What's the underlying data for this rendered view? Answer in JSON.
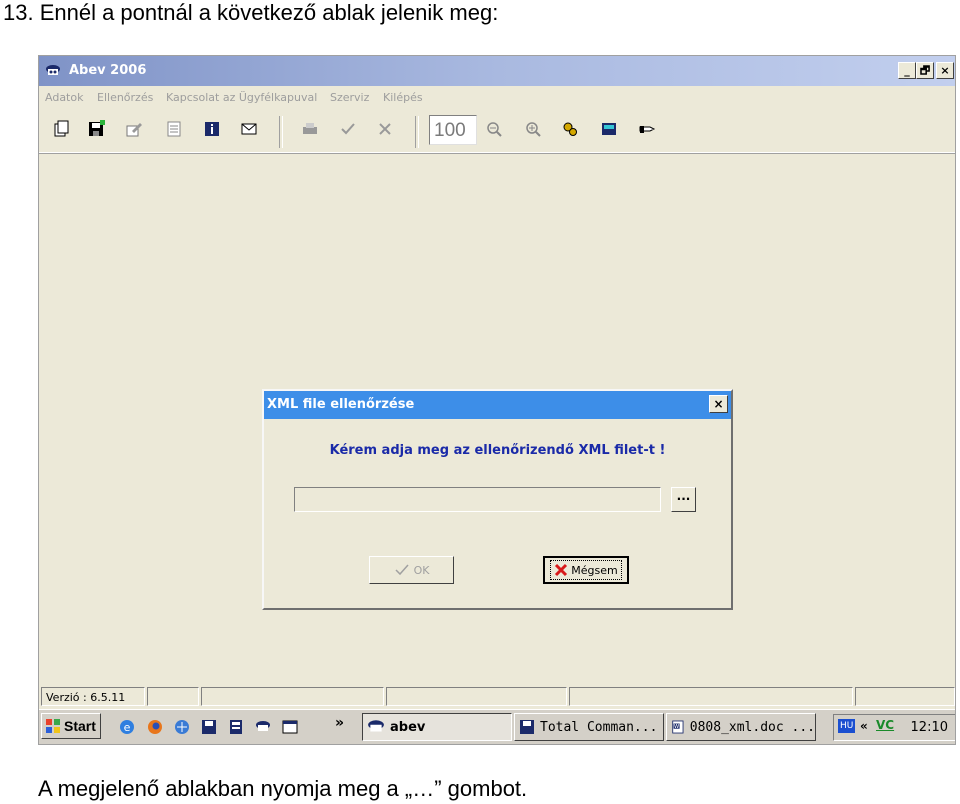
{
  "document": {
    "heading": "13. Ennél a pontnál a következő ablak jelenik meg:",
    "caption": "A megjelenő ablakban nyomja meg a „…” gombot."
  },
  "window": {
    "title": "Abev 2006",
    "app_icon": "abev-app-icon",
    "controls": {
      "minimize": "_",
      "restore": "🗗",
      "close": "×"
    }
  },
  "menu": {
    "items": [
      "Adatok",
      "Ellenőrzés",
      "Kapcsolat az Ügyfélkapuval",
      "Szerviz",
      "Kilépés"
    ]
  },
  "toolbar": {
    "icons": [
      "open-forms-icon",
      "save-icon",
      "edit-icon",
      "print-preview-icon",
      "info-icon",
      "mail-icon",
      "print-icon",
      "check-icon",
      "cancel-icon",
      "zoom-out-icon",
      "zoom-in-icon",
      "settings-icon",
      "calculator-icon",
      "pointer-hand-icon"
    ],
    "zoom_value": "100"
  },
  "dialog": {
    "title": "XML file ellenőrzése",
    "close": "×",
    "prompt": "Kérem adja meg az ellenőrizendő XML filet-t !",
    "file_path": "",
    "browse_label": "...",
    "ok_label": "OK",
    "cancel_label": "Mégsem"
  },
  "statusbar": {
    "version": "Verzió : 6.5.11"
  },
  "taskbar": {
    "start_label": "Start",
    "quicklaunch_icons": [
      "ie-icon",
      "firefox-icon",
      "browser-icon",
      "floppy-icon",
      "app-icon",
      "abev-icon",
      "window-icon"
    ],
    "more": "»",
    "tasks": [
      {
        "label": "abev",
        "icon": "abev-icon",
        "active": true
      },
      {
        "label": "Total Comman...",
        "icon": "floppy-icon",
        "active": false
      },
      {
        "label": "0808_xml.doc ...",
        "icon": "word-doc-icon",
        "active": false
      }
    ],
    "tray": {
      "lang": "HU",
      "arrows": "«",
      "vc": "VC",
      "clock": "12:10"
    }
  },
  "colors": {
    "titlebar": "#8a9cd1",
    "dialog_titlebar": "#3d8ee8",
    "prompt_text": "#1a2aa8",
    "window_bg": "#ece9d8"
  }
}
